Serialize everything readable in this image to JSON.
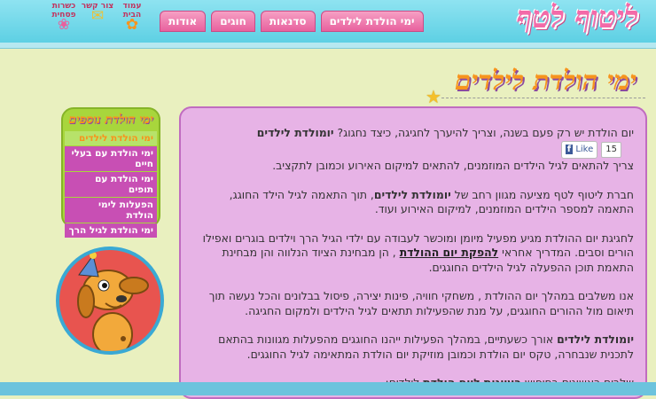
{
  "header": {
    "logo": "ליטוף לטף",
    "nav": [
      "אודות",
      "חוגים",
      "סדנאות",
      "ימי הולדת לילדים"
    ],
    "util": [
      {
        "label": "עמוד הבית",
        "icon": "star-icon"
      },
      {
        "label": "צור קשר",
        "icon": "envelope-icon"
      },
      {
        "label": "כשרות פסחית",
        "icon": "paw-icon"
      }
    ]
  },
  "page_title": "ימי הולדת לילדים",
  "facebook": {
    "count": "15",
    "like_label": "Like"
  },
  "content": {
    "p1_pre": "יום הולדת יש רק פעם בשנה, וצריך להיערך לחגיגה, כיצד נחגוג?",
    "p1_bold": "יומולדת לילדים",
    "p1_post": "צריך להתאים לגיל הילדים המוזמנים, להתאים למיקום האירוע וכמובן לתקציב.",
    "p2_pre": "חברת ליטוף לטף מציעה מגוון רחב של",
    "p2_bold": "יומולדת לילדים",
    "p2_post": ", תוך התאמה לגיל הילד החוגג, התאמה למספר הילדים המוזמנים, למיקום האירוע ועוד.",
    "p3_pre": "לחגיגת יום ההולדת מגיע מפעיל מיומן ומוכשר לעבודה עם ילדי הגיל הרך וילדים בוגרים ואפילו הורים וסבים. המדריך אחראי",
    "p3_link": "להפקת יום ההולדת",
    "p3_post": ", הן מבחינת הציוד הנלווה והן מבחינת התאמת תוכן ההפעלה לגיל הילדים החוגגים.",
    "p4": "אנו משלבים במהלך יום ההולדת , משחקי חוויה, פינות יצירה, פיסול בבלונים והכל נעשה תוך תיאום מול ההורים החוגגים, על מנת שהפעילות תתאים לגיל הילדים ולמקום החגיגה.",
    "p5_bold": "יומולדת לילדים",
    "p5_post": "אורך כשעתיים, במהלך הפעילות ייהנו החוגגים מהפעלות מגוונות בהתאם לתכנית שנבחרה, טקס יום הולדת וכמובן מוזיקת יום הולדת המתאימה לגיל החוגגים.",
    "p6_pre": "שלבים ראשונים בחיפוש",
    "p6_bold": "רעיונות ליום הולדת",
    "p6_post": "לילדים:"
  },
  "sidebar": {
    "title": "ימי הולדת נוספים",
    "items": [
      "ימי הולדת לילדים",
      "ימי הולדת עם בעלי חיים",
      "ימי הולדת עם תופים",
      "הפעלות לימי הולדת",
      "ימי הולדת לגיל הרך"
    ]
  },
  "colors": {
    "accent_pink": "#e8619e",
    "content_bg": "#e7b3e6",
    "sidebar_green": "#a8d63c",
    "title_orange": "#f7941d"
  }
}
